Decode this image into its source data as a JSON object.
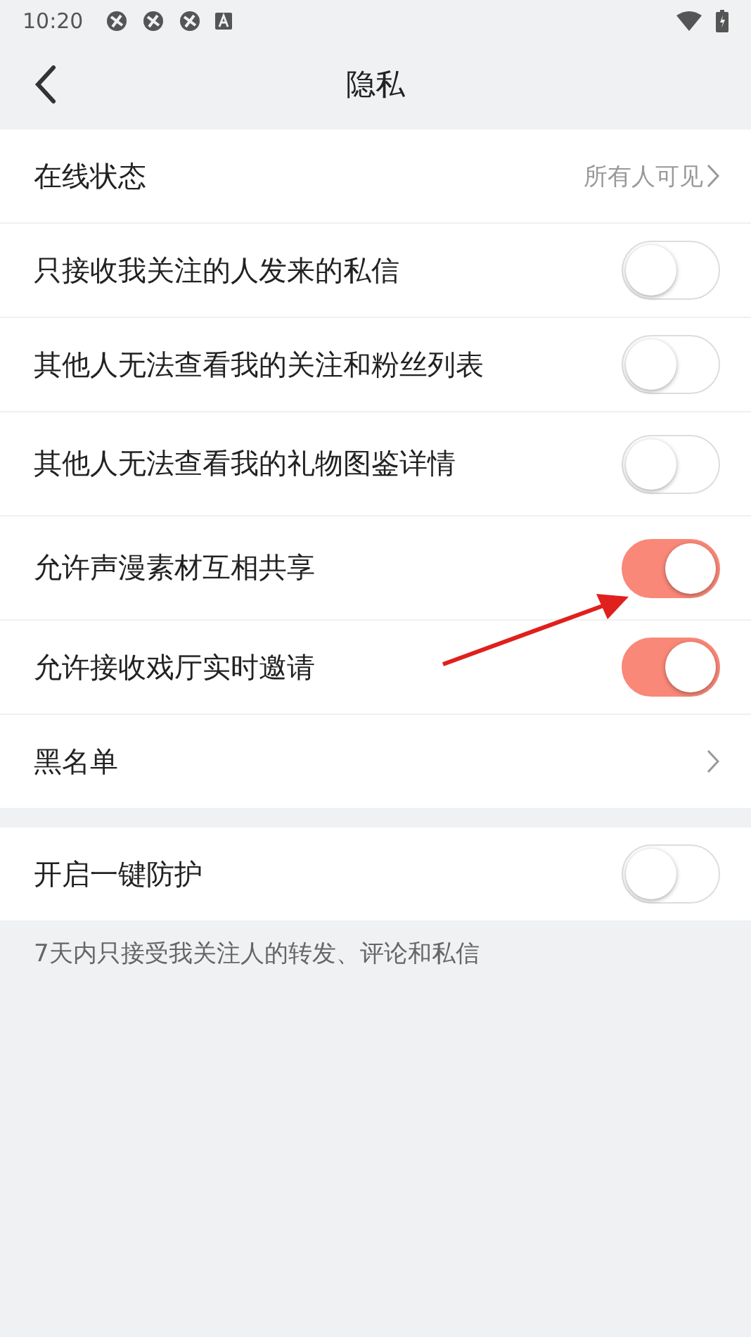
{
  "status_bar": {
    "time": "10:20"
  },
  "header": {
    "title": "隐私"
  },
  "sections": [
    {
      "rows": [
        {
          "kind": "link",
          "label": "在线状态",
          "value": "所有人可见"
        },
        {
          "kind": "toggle",
          "label": "只接收我关注的人发来的私信",
          "on": false
        },
        {
          "kind": "toggle",
          "label": "其他人无法查看我的关注和粉丝列表",
          "on": false
        },
        {
          "kind": "toggle",
          "label": "其他人无法查看我的礼物图鉴详情",
          "on": false
        },
        {
          "kind": "toggle",
          "label": "允许声漫素材互相共享",
          "on": true
        },
        {
          "kind": "toggle",
          "label": "允许接收戏厅实时邀请",
          "on": true
        },
        {
          "kind": "link",
          "label": "黑名单"
        }
      ]
    },
    {
      "rows": [
        {
          "kind": "toggle",
          "label": "开启一键防护",
          "on": false
        }
      ],
      "note": "7天内只接受我关注人的转发、评论和私信"
    }
  ],
  "annotations": [
    {
      "kind": "arrow"
    }
  ]
}
